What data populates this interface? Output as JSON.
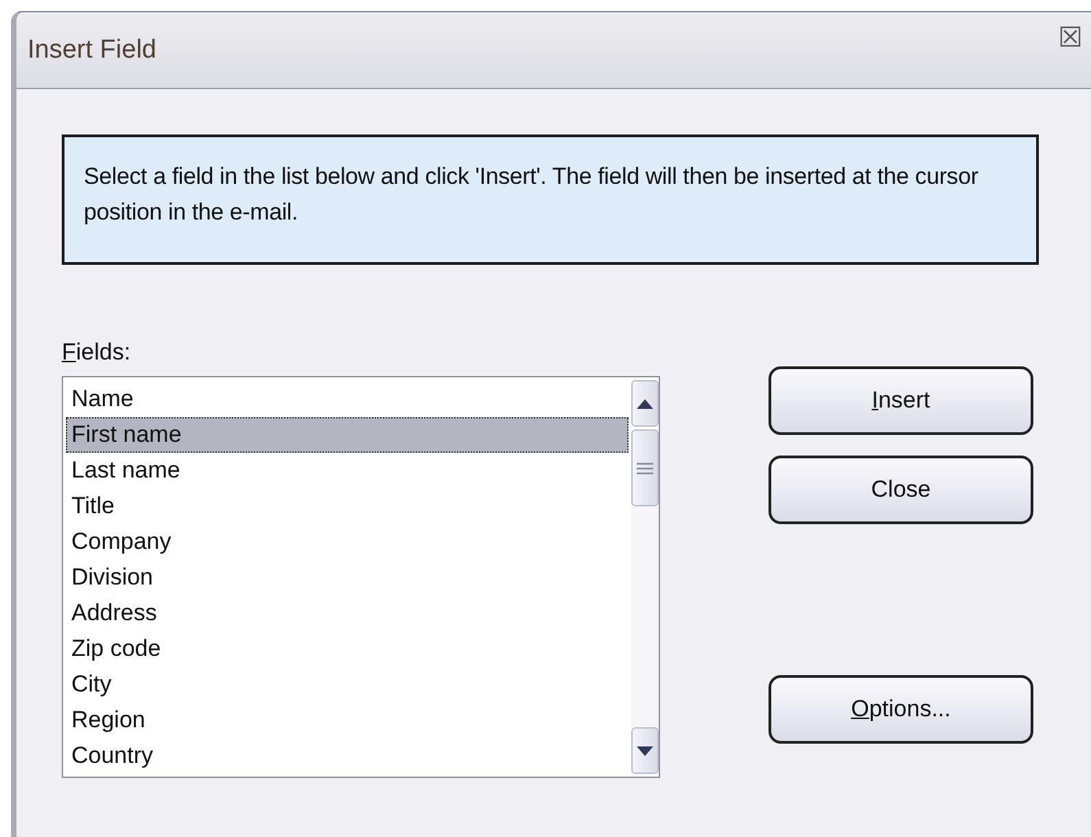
{
  "window": {
    "title": "Insert Field",
    "close_glyph": "☒"
  },
  "info": "Select a field in the list below and click 'Insert'. The field will then be inserted at the cursor position in the e-mail.",
  "fields_label": {
    "text": "Fields:",
    "mnemonic": true
  },
  "fields": [
    {
      "label": "Name",
      "selected": false
    },
    {
      "label": "First name",
      "selected": true
    },
    {
      "label": "Last name",
      "selected": false
    },
    {
      "label": "Title",
      "selected": false
    },
    {
      "label": "Company",
      "selected": false
    },
    {
      "label": "Division",
      "selected": false
    },
    {
      "label": "Address",
      "selected": false
    },
    {
      "label": "Zip code",
      "selected": false
    },
    {
      "label": "City",
      "selected": false
    },
    {
      "label": "Region",
      "selected": false
    },
    {
      "label": "Country",
      "selected": false
    }
  ],
  "buttons": [
    {
      "label": "Insert",
      "mnemonic": true
    },
    {
      "label": "Close",
      "mnemonic": false
    },
    {
      "label": "Options...",
      "mnemonic": true
    }
  ]
}
